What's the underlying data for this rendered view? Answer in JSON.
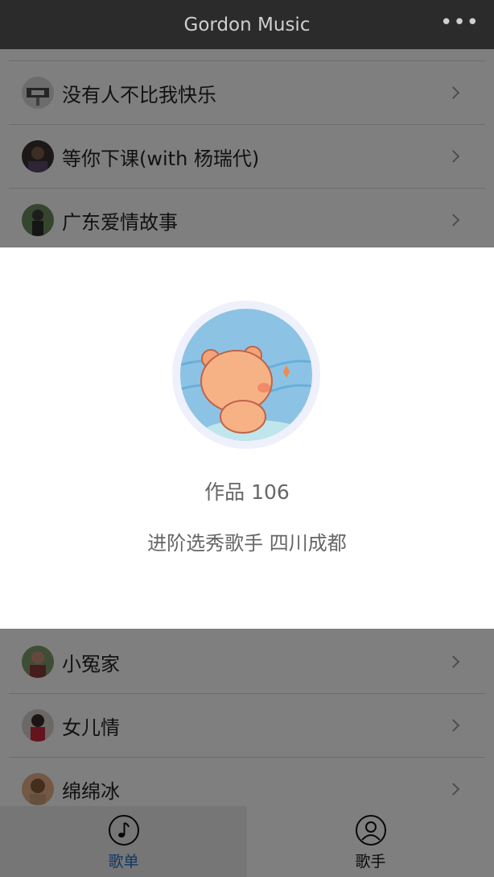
{
  "header": {
    "title": "Gordon Music",
    "more_icon": "more-dots-icon"
  },
  "songs_top": [
    {
      "title": "没有人不比我快乐"
    },
    {
      "title": "等你下课(with 杨瑞代)"
    },
    {
      "title": "广东爱情故事"
    }
  ],
  "songs_bottom": [
    {
      "title": "小冤家"
    },
    {
      "title": "女儿情"
    },
    {
      "title": "绵绵冰"
    }
  ],
  "modal": {
    "works": "作品 106",
    "description": "进阶选秀歌手 四川成都",
    "avatar_icon": "bear-cartoon-avatar"
  },
  "tabs": [
    {
      "label": "歌单",
      "icon": "music-note-icon",
      "active": true
    },
    {
      "label": "歌手",
      "icon": "user-icon",
      "active": false
    }
  ],
  "colors": {
    "header_bg": "#2b2b2b",
    "active_tab": "#1e6fc8",
    "overlay": "rgba(0,0,0,0.5)"
  }
}
